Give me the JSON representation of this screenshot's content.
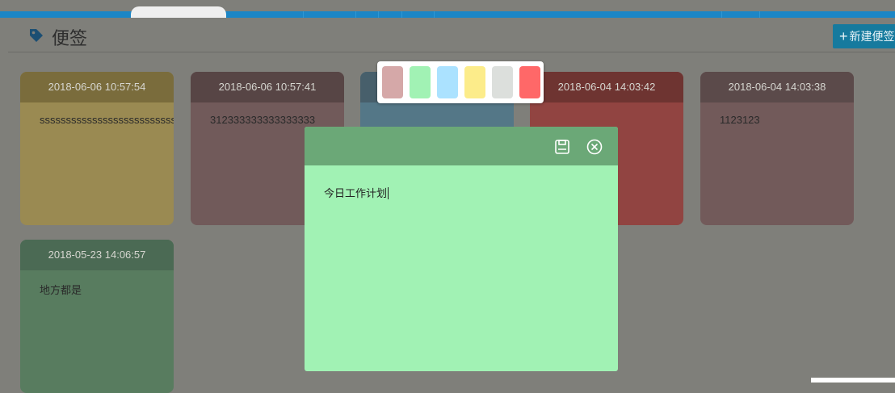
{
  "header": {
    "title": "便签",
    "new_button_label": "新建便签",
    "new_button_icon": "plus-icon",
    "title_icon": "tag-icon"
  },
  "notes": [
    {
      "time": "2018-06-06 10:57:54",
      "content": "ssssssssssssssssssssssssss",
      "header_color": "#7a6c3c",
      "body_color": "#9a8a52"
    },
    {
      "time": "2018-06-06 10:57:41",
      "content": "312333333333333333",
      "header_color": "#574545",
      "body_color": "#715a5a"
    },
    {
      "time": "",
      "content": "",
      "header_color": "#475f6b",
      "body_color": "#547787"
    },
    {
      "time": "2018-06-04 14:03:42",
      "content": "",
      "header_color": "#6e3431",
      "body_color": "#914441"
    },
    {
      "time": "2018-06-04 14:03:38",
      "content": "1123123",
      "header_color": "#5b4a4a",
      "body_color": "#725a5a"
    },
    {
      "time": "2018-05-23 14:06:57",
      "content": "地方都是",
      "header_color": "#4b6a54",
      "body_color": "#587c5f"
    }
  ],
  "palette": {
    "colors": [
      "#d5a8a8",
      "#a1f2b4",
      "#abe2ff",
      "#fcec8a",
      "#dcdfdc",
      "#ff6868"
    ]
  },
  "editor": {
    "content": "今日工作计划",
    "save_icon": "save-icon",
    "close_icon": "close-circle-icon",
    "header_color": "#6ba877",
    "body_color": "#a1f2b4"
  }
}
